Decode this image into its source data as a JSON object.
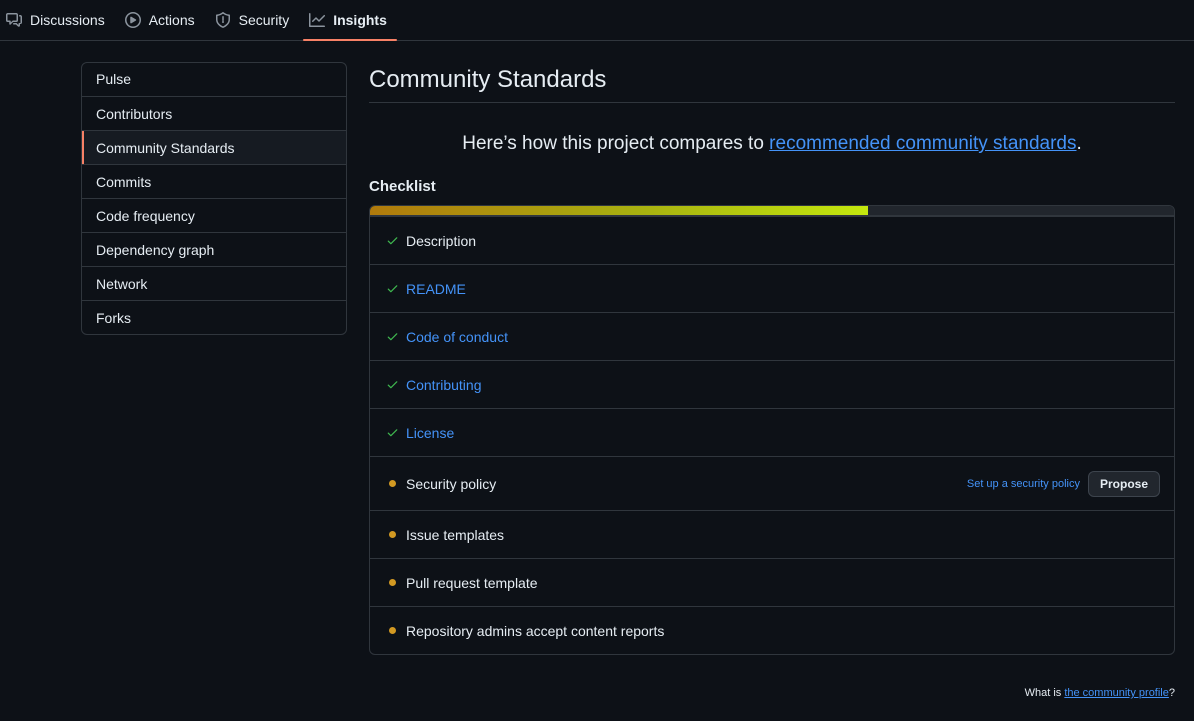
{
  "nav": {
    "tabs": [
      {
        "label": "Discussions",
        "icon": "comment-discussion-icon"
      },
      {
        "label": "Actions",
        "icon": "play-icon"
      },
      {
        "label": "Security",
        "icon": "shield-icon"
      },
      {
        "label": "Insights",
        "icon": "graph-icon",
        "active": true
      }
    ]
  },
  "sidebar": {
    "items": [
      {
        "label": "Pulse"
      },
      {
        "label": "Contributors"
      },
      {
        "label": "Community Standards",
        "selected": true
      },
      {
        "label": "Commits"
      },
      {
        "label": "Code frequency"
      },
      {
        "label": "Dependency graph"
      },
      {
        "label": "Network"
      },
      {
        "label": "Forks"
      }
    ]
  },
  "main": {
    "title": "Community Standards",
    "lead_prefix": "Here’s how this project compares to ",
    "lead_link": "recommended community standards",
    "lead_suffix": ".",
    "checklist_title": "Checklist",
    "progress_fraction": 0.62,
    "items": [
      {
        "label": "Description",
        "status": "done",
        "link": false
      },
      {
        "label": "README",
        "status": "done",
        "link": true
      },
      {
        "label": "Code of conduct",
        "status": "done",
        "link": true
      },
      {
        "label": "Contributing",
        "status": "done",
        "link": true
      },
      {
        "label": "License",
        "status": "done",
        "link": true
      },
      {
        "label": "Security policy",
        "status": "missing",
        "link": false,
        "action_link": "Set up a security policy",
        "action_button": "Propose"
      },
      {
        "label": "Issue templates",
        "status": "missing",
        "link": false
      },
      {
        "label": "Pull request template",
        "status": "missing",
        "link": false
      },
      {
        "label": "Repository admins accept content reports",
        "status": "missing",
        "link": false
      }
    ]
  },
  "footer": {
    "prefix": "What is ",
    "link": "the community profile",
    "suffix": "?"
  },
  "colors": {
    "accent": "#f78166",
    "link": "#4493f8",
    "check": "#3fb950",
    "pending": "#d29922"
  }
}
